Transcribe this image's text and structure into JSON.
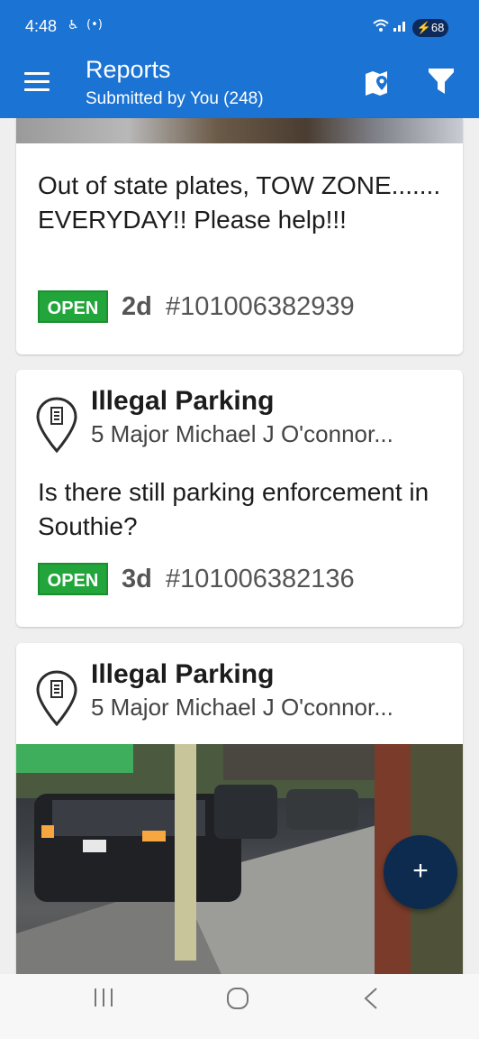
{
  "status_bar": {
    "time": "4:48",
    "battery": "68"
  },
  "app_bar": {
    "title": "Reports",
    "subtitle": "Submitted by You (248)"
  },
  "cards": [
    {
      "description": "Out of state plates, TOW ZONE....... EVERYDAY!! Please help!!!",
      "status": "OPEN",
      "age": "2d",
      "id": "#101006382939"
    },
    {
      "category": "Illegal Parking",
      "address": "5 Major Michael J O'connor...",
      "description": "Is there still parking enforcement in Southie?",
      "status": "OPEN",
      "age": "3d",
      "id": "#101006382136"
    },
    {
      "category": "Illegal Parking",
      "address": "5 Major Michael J O'connor..."
    }
  ],
  "fab": {
    "label": "+"
  },
  "icons": {
    "menu": "menu-icon",
    "map": "map-pin-icon",
    "filter": "filter-icon",
    "pin": "location-pin-icon"
  },
  "colors": {
    "app_bar": "#1b73d3",
    "status_open": "#22a63b",
    "fab": "#0c2b4f"
  }
}
